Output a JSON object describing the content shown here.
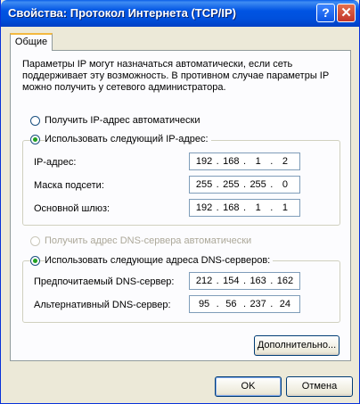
{
  "window": {
    "title": "Свойства: Протокол Интернета (TCP/IP)",
    "help_glyph": "?",
    "close_glyph": "✕"
  },
  "tab": {
    "label": "Общие"
  },
  "description": "Параметры IP могут назначаться автоматически, если сеть поддерживает эту возможность. В противном случае параметры IP можно получить у сетевого администратора.",
  "ip_mode": {
    "auto_label": "Получить IP-адрес автоматически",
    "manual_label": "Использовать следующий IP-адрес:",
    "selected": "manual"
  },
  "ip_fields": [
    {
      "label": "IP-адрес:",
      "octets": [
        "192",
        "168",
        "1",
        "2"
      ]
    },
    {
      "label": "Маска подсети:",
      "octets": [
        "255",
        "255",
        "255",
        "0"
      ]
    },
    {
      "label": "Основной шлюз:",
      "octets": [
        "192",
        "168",
        "1",
        "1"
      ]
    }
  ],
  "dns_mode": {
    "auto_label": "Получить адрес DNS-сервера автоматически",
    "manual_label": "Использовать следующие адреса DNS-серверов:",
    "selected": "manual"
  },
  "dns_fields": [
    {
      "label": "Предпочитаемый DNS-сервер:",
      "octets": [
        "212",
        "154",
        "163",
        "162"
      ]
    },
    {
      "label": "Альтернативный DNS-сервер:",
      "octets": [
        "95",
        "56",
        "237",
        "24"
      ]
    }
  ],
  "buttons": {
    "advanced": "Дополнительно...",
    "ok": "OK",
    "cancel": "Отмена"
  },
  "colors": {
    "title_bar": "#0054e3",
    "window_bg": "#ece9d8",
    "radio_dot": "#21a121"
  }
}
